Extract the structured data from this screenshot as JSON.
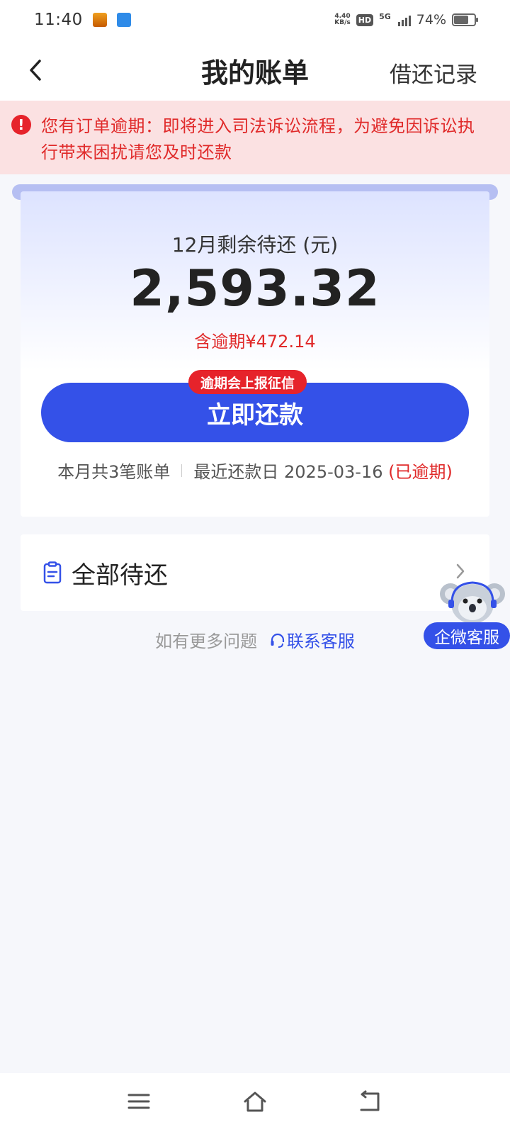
{
  "status_bar": {
    "time": "11:40",
    "net_speed_value": "4.40",
    "net_speed_unit": "KB/s",
    "hd": "HD",
    "network": "5G",
    "battery_percent": "74%",
    "battery_level": 0.74
  },
  "header": {
    "title": "我的账单",
    "right_action": "借还记录"
  },
  "alert": {
    "text": "您有订单逾期：即将进入司法诉讼流程，为避免因诉讼执行带来困扰请您及时还款",
    "icon": "exclamation-icon"
  },
  "bill": {
    "label": "12月剩余待还 (元)",
    "amount": "2,593.32",
    "overdue_amount": "含逾期¥472.14",
    "credit_badge": "逾期会上报征信",
    "pay_button": "立即还款",
    "bill_count": "本月共3笔账单",
    "due_date": "最近还款日 2025-03-16",
    "overdue_tag": "(已逾期)"
  },
  "all_pending": {
    "label": "全部待还"
  },
  "help": {
    "text": "如有更多问题",
    "link": "联系客服"
  },
  "wecom": {
    "label": "企微客服"
  },
  "colors": {
    "primary": "#3451e8",
    "alert_red": "#e02a2a",
    "alert_bg": "#fbe1e2"
  }
}
